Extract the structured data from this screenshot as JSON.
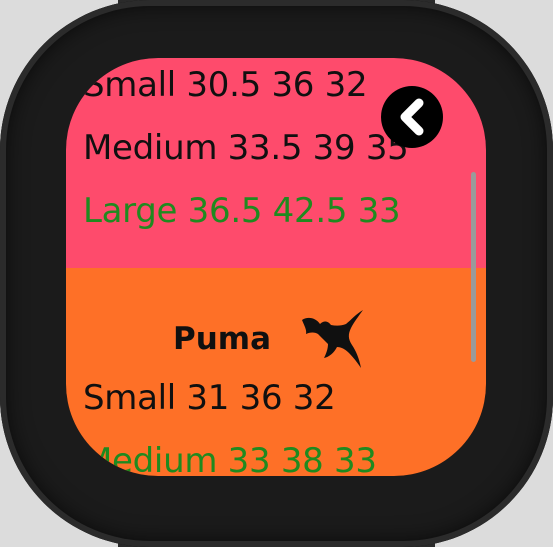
{
  "cards": [
    {
      "rows": [
        {
          "text": "Small 30.5 36 32",
          "color": "#101010"
        },
        {
          "text": "Medium 33.5 39 35",
          "color": "#101010"
        },
        {
          "text": "Large 36.5 42.5 33",
          "color": "#1f8a1f"
        }
      ],
      "background": "#fe4b6c"
    },
    {
      "brand": "Puma",
      "logo_icon": "puma-logo",
      "rows": [
        {
          "text": "Small 31 36 32",
          "color": "#101010"
        },
        {
          "text": "Medium 33 38 33",
          "color": "#1f8a1f"
        }
      ],
      "background": "#fe7027"
    }
  ],
  "back_button_icon": "chevron-left-icon"
}
